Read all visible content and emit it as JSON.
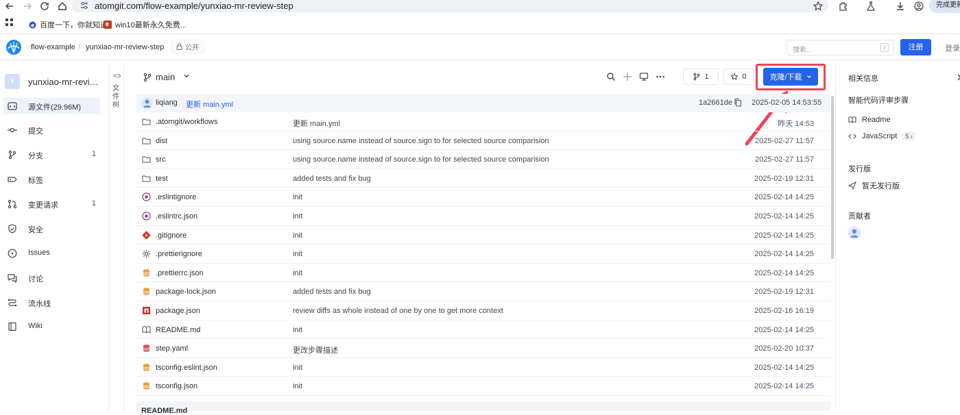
{
  "browser": {
    "url": "atomgit.com/flow-example/yunxiao-mr-review-step",
    "update_button": "完成更新",
    "bookmarks": [
      {
        "label": "百度一下，你就知道",
        "icon": "baidu-icon"
      },
      {
        "label": "win10最新永久免费...",
        "icon": "site-icon"
      }
    ]
  },
  "header": {
    "owner": "flow-example",
    "separator": "/",
    "repo": "yunxiao-mr-review-step",
    "visibility": "公开",
    "search_placeholder": "搜索...",
    "search_shortcut": "/",
    "register": "注册",
    "login": "登录"
  },
  "sidebar": {
    "avatar_letter": "Y",
    "repo_name": "yunxiao-mr-review-step",
    "items": [
      {
        "label": "源文件(29.96M)",
        "count": "",
        "icon": "code-icon",
        "active": true
      },
      {
        "label": "提交",
        "count": "",
        "icon": "commit-icon"
      },
      {
        "label": "分支",
        "count": "1",
        "icon": "branch-icon"
      },
      {
        "label": "标签",
        "count": "",
        "icon": "tag-icon"
      },
      {
        "label": "变更请求",
        "count": "1",
        "icon": "pull-request-icon"
      },
      {
        "label": "安全",
        "count": "",
        "icon": "shield-icon"
      },
      {
        "label": "Issues",
        "count": "",
        "icon": "issue-icon"
      },
      {
        "label": "讨论",
        "count": "",
        "icon": "discussion-icon"
      },
      {
        "label": "流水线",
        "count": "",
        "icon": "pipeline-icon"
      },
      {
        "label": "Wiki",
        "count": "",
        "icon": "book-icon"
      }
    ],
    "file_tree_arrows": "<>",
    "file_tree_label": "文件树"
  },
  "main": {
    "branch": "main",
    "branch_count": "1",
    "star_count": "0",
    "clone_button": "克隆/下载",
    "last_commit": {
      "author": "liqiang",
      "message": "更新 main.yml",
      "hash": "1a2661de",
      "date": "2025-02-05 14:53:55"
    },
    "files": [
      {
        "name": ".atomgit/workflows",
        "message": "更新 main.yml",
        "date": "昨天 14:53",
        "icon": "folder-icon"
      },
      {
        "name": "dist",
        "message": "using source.name instead of source.sign to for selected source comparision",
        "date": "2025-02-27 11:57",
        "icon": "folder-icon"
      },
      {
        "name": "src",
        "message": "using source.name instead of source.sign to for selected source comparision",
        "date": "2025-02-27 11:57",
        "icon": "folder-icon"
      },
      {
        "name": "test",
        "message": "added tests and fix bug",
        "date": "2025-02-19 12:31",
        "icon": "folder-icon"
      },
      {
        "name": ".eslintignore",
        "message": "init",
        "date": "2025-02-14 14:25",
        "icon": "eslint-icon"
      },
      {
        "name": ".eslintrc.json",
        "message": "init",
        "date": "2025-02-14 14:25",
        "icon": "eslint-icon"
      },
      {
        "name": ".gitignore",
        "message": "init",
        "date": "2025-02-14 14:25",
        "icon": "git-icon"
      },
      {
        "name": ".prettierignore",
        "message": "init",
        "date": "2025-02-14 14:25",
        "icon": "gear-icon"
      },
      {
        "name": ".prettierrc.json",
        "message": "init",
        "date": "2025-02-14 14:25",
        "icon": "json-icon"
      },
      {
        "name": "package-lock.json",
        "message": "added tests and fix bug",
        "date": "2025-02-19 12:31",
        "icon": "json-icon"
      },
      {
        "name": "package.json",
        "message": "review diffs as whole instead of one by one to get more context",
        "date": "2025-02-16 16:19",
        "icon": "npm-icon"
      },
      {
        "name": "README.md",
        "message": "init",
        "date": "2025-02-14 14:25",
        "icon": "readme-icon"
      },
      {
        "name": "step.yaml",
        "message": "更改步骤描述",
        "date": "2025-02-20 10:37",
        "icon": "yaml-icon"
      },
      {
        "name": "tsconfig.eslint.json",
        "message": "init",
        "date": "2025-02-14 14:25",
        "icon": "json-icon"
      },
      {
        "name": "tsconfig.json",
        "message": "init",
        "date": "2025-02-14 14:25",
        "icon": "json-icon"
      }
    ],
    "readme_title": "README.md"
  },
  "right_panel": {
    "related_info": "相关信息",
    "description": "智能代码评审步骤",
    "readme": "Readme",
    "language": "JavaScript",
    "language_count": "5",
    "releases_title": "发行版",
    "no_releases": "暂无发行版",
    "contributors_title": "贡献者"
  },
  "colors": {
    "accent": "#2563eb",
    "highlight": "#f0415a",
    "active_bg": "#eef3fb"
  }
}
